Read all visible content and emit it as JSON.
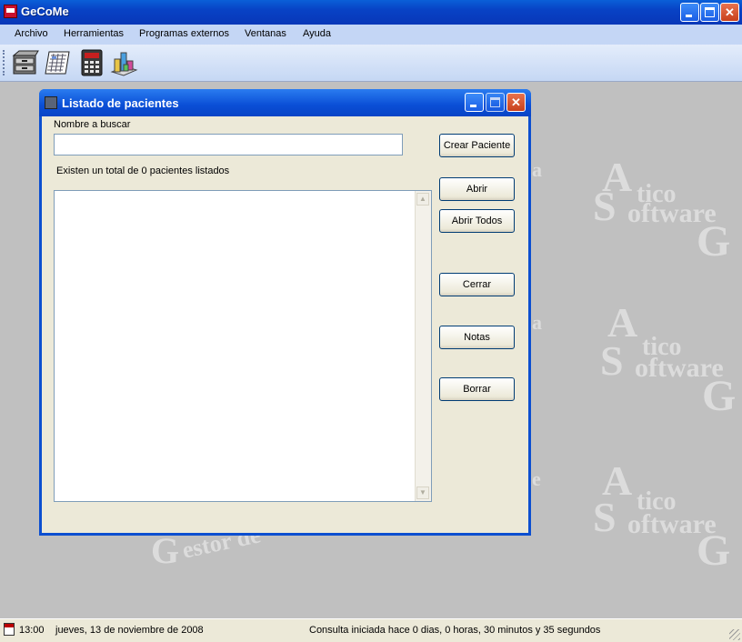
{
  "app": {
    "title": "GeCoMe"
  },
  "menu": [
    {
      "label": "Archivo"
    },
    {
      "label": "Herramientas"
    },
    {
      "label": "Programas externos"
    },
    {
      "label": "Ventanas"
    },
    {
      "label": "Ayuda"
    }
  ],
  "toolbar": {
    "items": [
      {
        "icon": "filing-cabinet-icon"
      },
      {
        "icon": "schedule-sheet-icon"
      },
      {
        "icon": "calculator-icon"
      },
      {
        "icon": "chart-cubes-icon"
      }
    ]
  },
  "watermark": {
    "brand_line1": "tico",
    "brand_line2": "oftware",
    "brand_initial": "A",
    "brand_initial2": "S",
    "g_letter": "G",
    "gestor": "estor de",
    "frag_a": "a",
    "frag_e": "e"
  },
  "dialog": {
    "title": "Listado de pacientes",
    "search_label": "Nombre a buscar",
    "search_value": "",
    "count_text": "Existen un total de 0 pacientes listados",
    "list_items": [],
    "buttons": {
      "create": "Crear Paciente",
      "open": "Abrir",
      "open_all": "Abrir Todos",
      "close": "Cerrar",
      "notes": "Notas",
      "delete": "Borrar"
    }
  },
  "statusbar": {
    "time": "13:00",
    "date": "jueves, 13 de noviembre de 2008",
    "session": "Consulta iniciada hace 0 dias, 0 horas, 30 minutos y 35 segundos"
  },
  "colors": {
    "titlebar": "#0842c5",
    "desktop": "#c0c0c0",
    "dialog_face": "#ece9d8",
    "menubar": "#c4d6f5"
  }
}
